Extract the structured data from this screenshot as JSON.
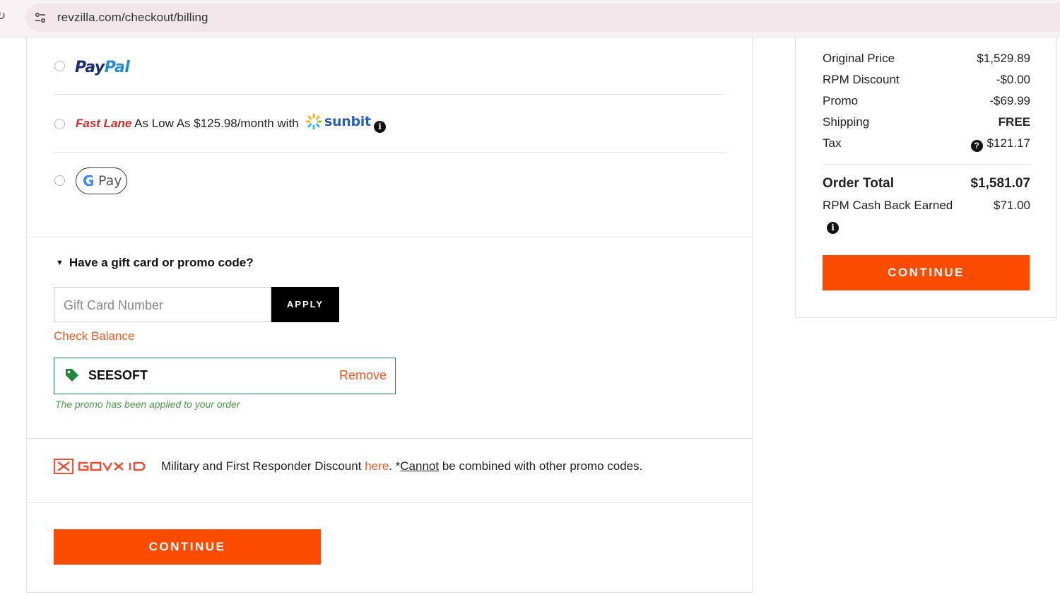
{
  "browser": {
    "url": "revzilla.com/checkout/billing"
  },
  "payment": {
    "paypal_logo_dark": "Pay",
    "paypal_logo_light": "Pal",
    "fastlane_label": "Fast Lane",
    "fastlane_text": "As Low As $125.98/month with",
    "sunbit_logo": "sunbit",
    "gpay_g": "G",
    "gpay_pay": "Pay"
  },
  "promo": {
    "toggle_label": "Have a gift card or promo code?",
    "input_placeholder": "Gift Card Number",
    "apply_label": "APPLY",
    "check_balance": "Check Balance",
    "applied_code": "SEESOFT",
    "remove_label": "Remove",
    "applied_message": "The promo has been applied to your order"
  },
  "govx": {
    "text_before": "Military and First Responder Discount",
    "link": "here",
    "separator": ". *",
    "cannot": "Cannot",
    "text_after": "be combined with other promo codes."
  },
  "buttons": {
    "continue": "CONTINUE"
  },
  "summary": {
    "original_price_label": "Original Price",
    "original_price_value": "$1,529.89",
    "rpm_discount_label": "RPM Discount",
    "rpm_discount_value": "-$0.00",
    "promo_label": "Promo",
    "promo_value": "-$69.99",
    "shipping_label": "Shipping",
    "shipping_value": "FREE",
    "tax_label": "Tax",
    "tax_value": "$121.17",
    "order_total_label": "Order Total",
    "order_total_value": "$1,581.07",
    "cash_back_label": "RPM Cash Back Earned",
    "cash_back_value": "$71.00"
  },
  "colors": {
    "accent_orange": "#fc4c02",
    "link_orange": "#f15a22",
    "success_green": "#2e7d4f",
    "paypal_dark": "#1b2f6e",
    "paypal_light": "#2a8ad6"
  }
}
